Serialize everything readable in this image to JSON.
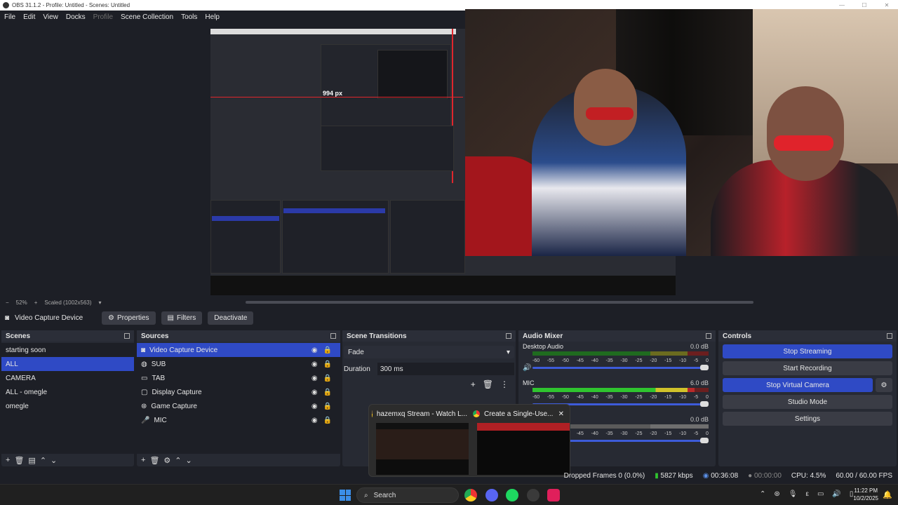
{
  "window": {
    "title": "OBS 31.1.2 - Profile: Untitled - Scenes: Untitled"
  },
  "menu": [
    "File",
    "Edit",
    "View",
    "Docks",
    "Profile",
    "Scene Collection",
    "Tools",
    "Help"
  ],
  "preview": {
    "measure_label": "994 px",
    "zoom": "52%",
    "scale_label": "Scaled (1002x563)"
  },
  "source_toolbar": {
    "source_name": "Video Capture Device",
    "properties": "Properties",
    "filters": "Filters",
    "deactivate": "Deactivate"
  },
  "scenes": {
    "title": "Scenes",
    "items": [
      "starting soon",
      "ALL",
      "CAMERA",
      "ALL - omegle",
      "omegle"
    ],
    "selected": "ALL"
  },
  "sources": {
    "title": "Sources",
    "items": [
      {
        "name": "Video Capture Device",
        "icon": "camera-icon"
      },
      {
        "name": "SUB",
        "icon": "globe-icon"
      },
      {
        "name": "TAB",
        "icon": "window-icon"
      },
      {
        "name": "Display Capture",
        "icon": "monitor-icon"
      },
      {
        "name": "Game Capture",
        "icon": "gamepad-icon"
      },
      {
        "name": "MIC",
        "icon": "mic-icon"
      }
    ]
  },
  "transitions": {
    "title": "Scene Transitions",
    "selected": "Fade",
    "duration_label": "Duration",
    "duration_value": "300 ms"
  },
  "mixer": {
    "title": "Audio Mixer",
    "channels": [
      {
        "name": "Desktop Audio",
        "db": "0.0 dB"
      },
      {
        "name": "MIC",
        "db": "6.0 dB"
      },
      {
        "name": "",
        "db": "0.0 dB"
      }
    ],
    "scale": [
      "-60",
      "-55",
      "-50",
      "-45",
      "-40",
      "-35",
      "-30",
      "-25",
      "-20",
      "-15",
      "-10",
      "-5",
      "0"
    ]
  },
  "controls": {
    "title": "Controls",
    "stop_streaming": "Stop Streaming",
    "start_recording": "Start Recording",
    "stop_virtual_camera": "Stop Virtual Camera",
    "studio_mode": "Studio Mode",
    "settings": "Settings"
  },
  "status": {
    "dropped_frames": "Dropped Frames 0 (0.0%)",
    "bitrate": "5827 kbps",
    "stream_time": "00:36:08",
    "record_time": "00:00:00",
    "cpu": "CPU: 4.5%",
    "fps": "60.00 / 60.00 FPS"
  },
  "taskbar": {
    "search_placeholder": "Search",
    "time": "11:22 PM",
    "date": "10/2/2025"
  },
  "thumbnails": [
    {
      "title": "hazemxq Stream - Watch L..."
    },
    {
      "title": "Create a Single-Use..."
    }
  ],
  "colors": {
    "accent": "#2f4ac5",
    "panel": "#272a33",
    "background": "#1d1f26"
  }
}
